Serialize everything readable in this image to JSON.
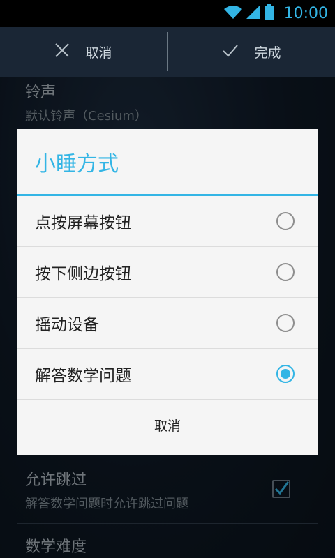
{
  "status_bar": {
    "time": "10:00"
  },
  "action_bar": {
    "cancel_label": "取消",
    "done_label": "完成"
  },
  "settings": {
    "ringtone_title": "铃声",
    "ringtone_value": "默认铃声（Cesium）",
    "allow_skip_title": "允许跳过",
    "allow_skip_desc": "解答数学问题时允许跳过问题",
    "math_difficulty_title": "数学难度"
  },
  "dialog": {
    "title": "小睡方式",
    "options": [
      {
        "label": "点按屏幕按钮",
        "checked": false
      },
      {
        "label": "按下侧边按钮",
        "checked": false
      },
      {
        "label": "摇动设备",
        "checked": false
      },
      {
        "label": "解答数学问题",
        "checked": true
      }
    ],
    "cancel_label": "取消"
  },
  "colors": {
    "accent": "#33b5e5",
    "dialog_bg": "#f5f5f5"
  }
}
